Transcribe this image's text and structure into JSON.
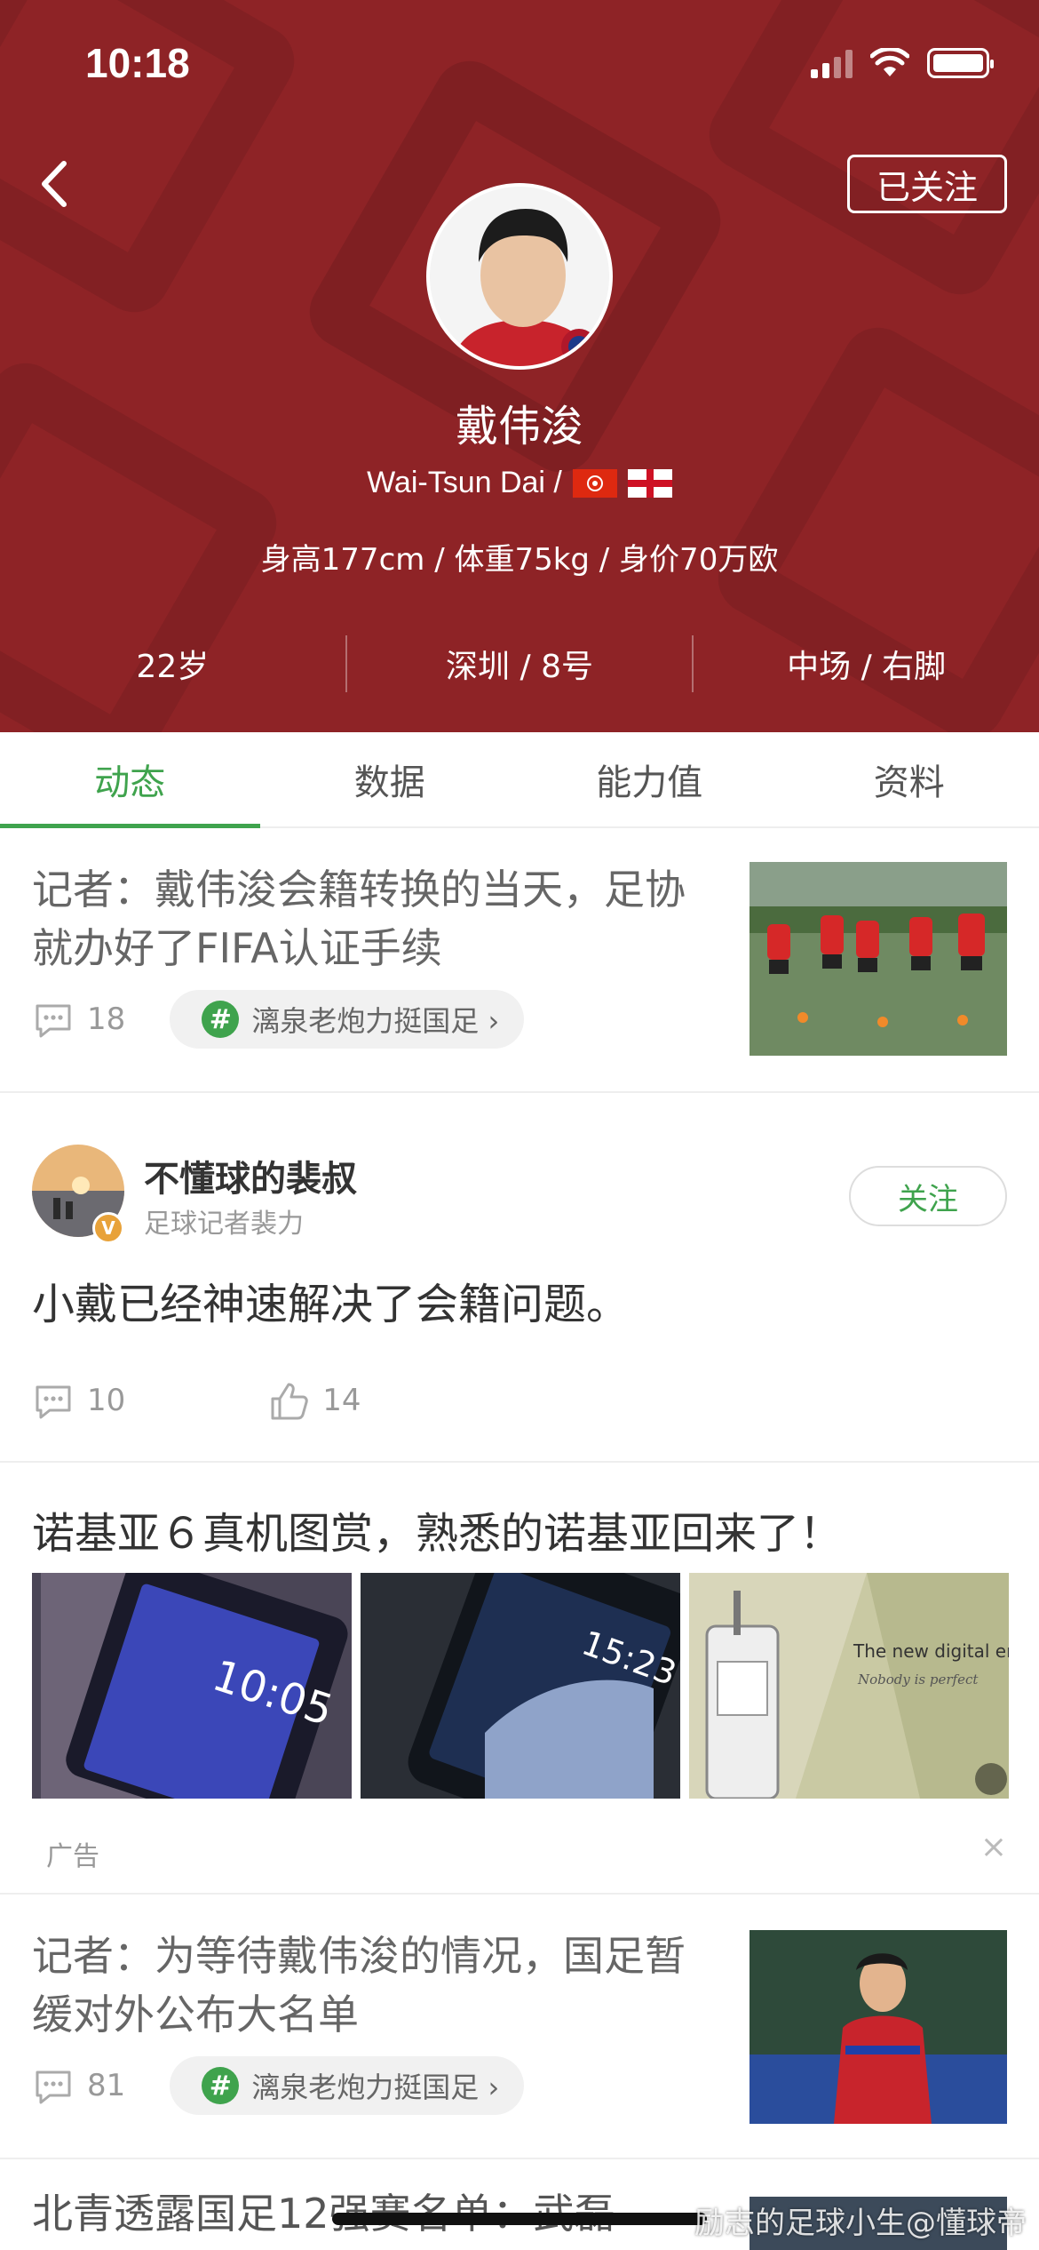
{
  "status_bar": {
    "time": "10:18"
  },
  "header": {
    "follow_label": "已关注",
    "name": "戴伟浚",
    "en_name": "Wai-Tsun Dai /",
    "stats": "身高177cm / 体重75kg / 身价70万欧",
    "info": [
      "22岁",
      "深圳 / 8号",
      "中场 / 右脚"
    ],
    "colors": {
      "header_bg": "#8e2326",
      "accent": "#3fa34d"
    }
  },
  "tabs": [
    {
      "label": "动态",
      "active": true
    },
    {
      "label": "数据",
      "active": false
    },
    {
      "label": "能力值",
      "active": false
    },
    {
      "label": "资料",
      "active": false
    }
  ],
  "feed": {
    "news1": {
      "title": "记者：戴伟浚会籍转换的当天，足协就办好了FIFA认证手续",
      "comments": "18",
      "topic": "漓泉老炮力挺国足 ›"
    },
    "post": {
      "author": "不懂球的裴叔",
      "subtitle": "足球记者裴力",
      "follow_label": "关注",
      "body": "小戴已经神速解决了会籍问题。",
      "comments": "10",
      "likes": "14",
      "badge": "V"
    },
    "ad": {
      "title": "诺基亚６真机图赏，熟悉的诺基亚回来了！",
      "label": "广告",
      "close": "×",
      "img1_time": "10:05",
      "img2_time": "15:23",
      "img3_text": "The new digital er",
      "img3_script": "Nobody is perfect"
    },
    "news2": {
      "title": "记者：为等待戴伟浚的情况，国足暂缓对外公布大名单",
      "comments": "81",
      "topic": "漓泉老炮力挺国足 ›"
    },
    "news3": {
      "title": "北青透露国足12强赛名单：武磊"
    }
  },
  "watermark": "励志的足球小生@懂球帝"
}
